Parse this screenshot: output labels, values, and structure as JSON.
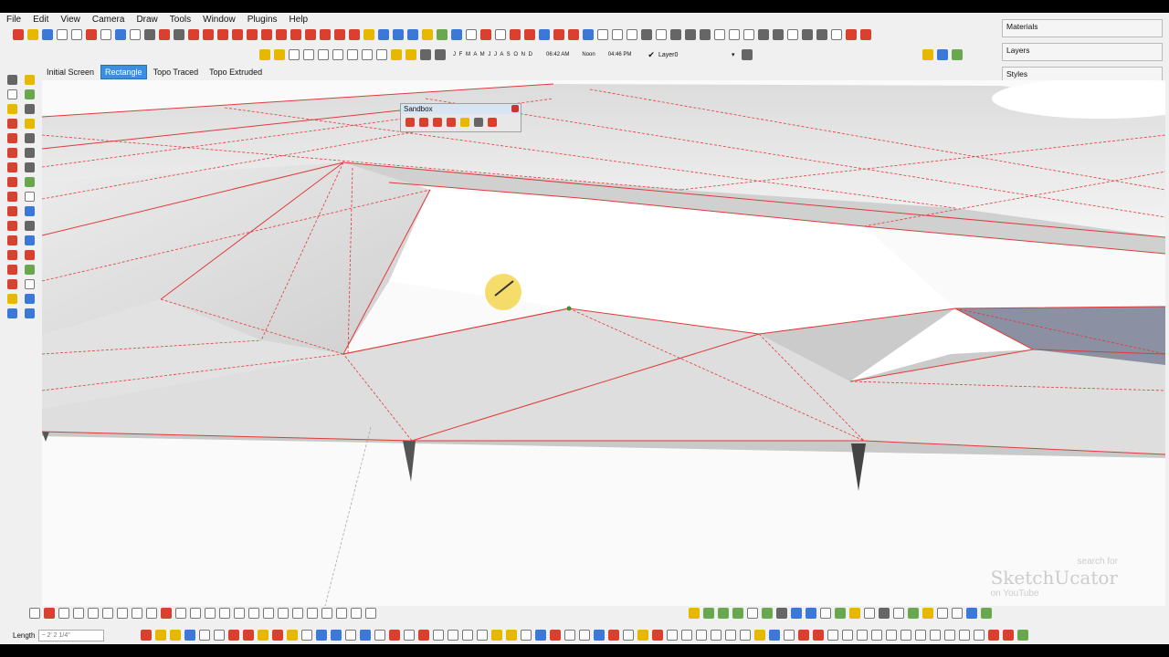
{
  "menu": [
    "File",
    "Edit",
    "View",
    "Camera",
    "Draw",
    "Tools",
    "Window",
    "Plugins",
    "Help"
  ],
  "shadow": {
    "months": "J F M A M J J A S O N D",
    "t1": "06:42 AM",
    "noon": "Noon",
    "t2": "04:46 PM"
  },
  "layer": "Layer0",
  "scene_tabs": [
    "Initial Screen",
    "Rectangle",
    "Topo Traced",
    "Topo Extruded"
  ],
  "trays": [
    "Materials",
    "Layers",
    "Styles"
  ],
  "sandbox_title": "Sandbox",
  "status": {
    "length_label": "Length",
    "length_value": "~ 2' 2 1/4\""
  },
  "watermark": {
    "top": "search for",
    "brand": "SketchUcator",
    "bottom": "on YouTube"
  },
  "colors": {
    "edge": "#e03a3a",
    "active_tab": "#3a8fe0",
    "roof": "#8b90a2"
  }
}
